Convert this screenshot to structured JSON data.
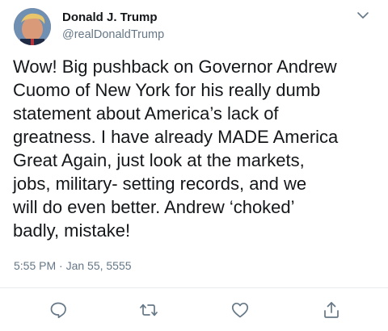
{
  "tweet": {
    "display_name": "Donald J. Trump",
    "handle": "@realDonaldTrump",
    "text": "Wow! Big pushback on Governor Andrew\nCuomo of New York for his really dumb\nstatement about America’s lack of\ngreatness. I have already MADE America\nGreat Again, just look at the markets,\njobs, military- setting records, and we\nwill do even better. Andrew ‘choked’\nbadly, mistake!",
    "timestamp": "5:55 PM · Jan 55, 5555"
  },
  "icons": {
    "menu": "chevron-down-icon",
    "reply": "reply-icon",
    "retweet": "retweet-icon",
    "like": "like-icon",
    "share": "share-icon"
  },
  "colors": {
    "text": "#14171a",
    "secondary": "#657786",
    "icon": "#657786",
    "divider": "#e6ecf0"
  }
}
